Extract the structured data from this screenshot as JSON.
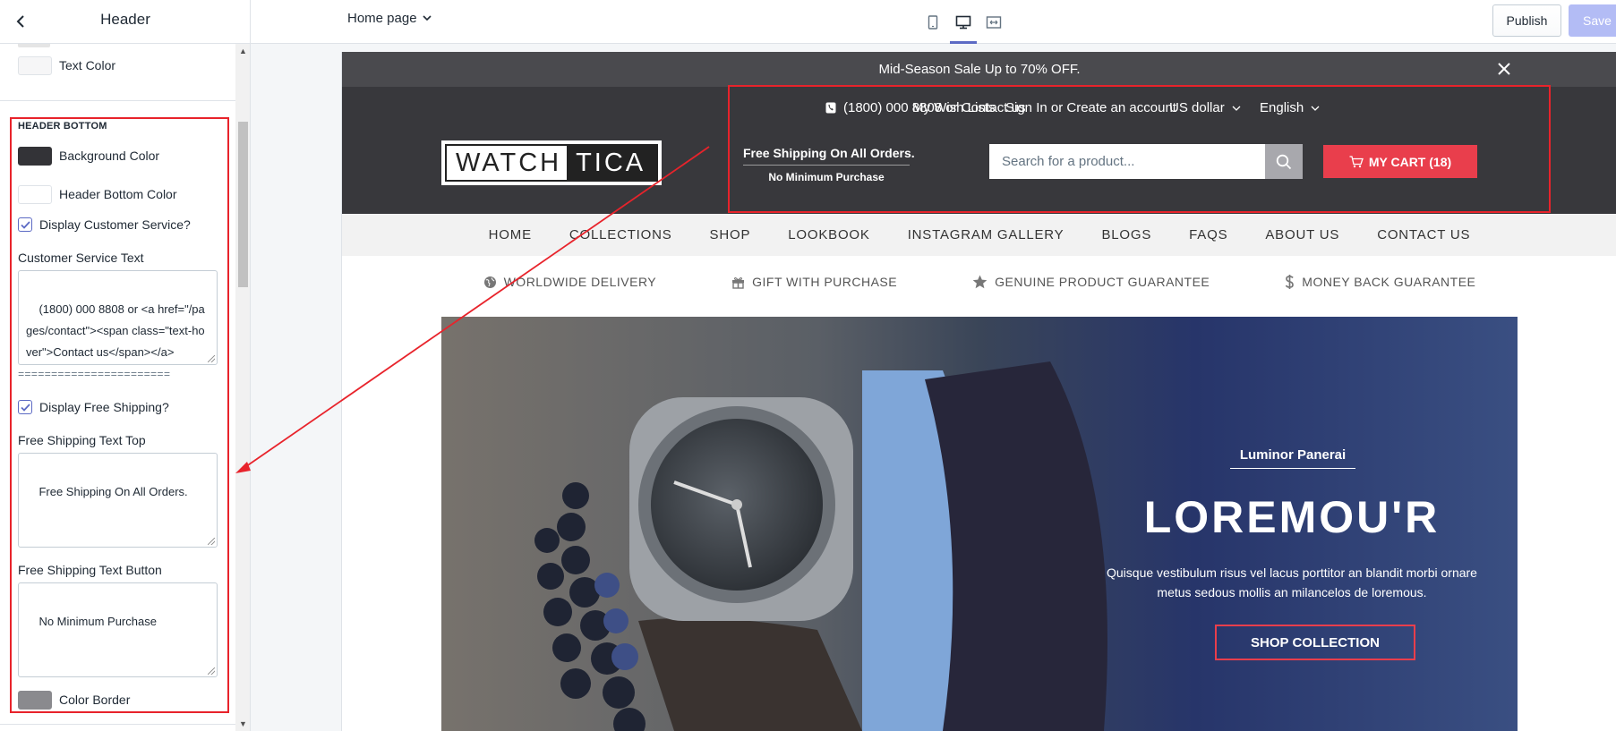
{
  "topbar": {
    "title": "Header",
    "page_select": "Home page",
    "publish_label": "Publish",
    "save_label": "Save",
    "accent_color": "#5c6ac4"
  },
  "panel": {
    "text_color_label": "Text Color",
    "section_title": "HEADER BOTTOM",
    "bg_color_label": "Background Color",
    "bg_color": "#333337",
    "header_bottom_color_label": "Header Bottom Color",
    "header_bottom_color": "#ffffff",
    "display_customer_service_label": "Display Customer Service?",
    "display_customer_service": true,
    "customer_service_text_label": "Customer Service Text",
    "customer_service_text": "(1800) 000 8808 or <a href=\"/pages/contact\"><span class=\"text-hover\">Contact us</span></a>",
    "separator": "=======================",
    "display_free_shipping_label": "Display Free Shipping?",
    "display_free_shipping": true,
    "free_shipping_top_label": "Free Shipping Text Top",
    "free_shipping_top": "Free Shipping On All Orders.",
    "free_shipping_button_label": "Free Shipping Text Button",
    "free_shipping_button": "No Minimum Purchase",
    "color_border_label": "Color Border",
    "color_border": "#8a8a8e"
  },
  "preview": {
    "announcement": "Mid-Season Sale Up to 70% OFF.",
    "logo": {
      "part1": "WATCH",
      "part2": "TICA"
    },
    "header_links": {
      "phone_text": "(1800) 000 8808 or Contact us",
      "wish_lists": "My Wish Lists",
      "sign_in": "Sign In or Create an account",
      "currency": "US dollar",
      "language": "English"
    },
    "free_shipping_top": "Free Shipping On All Orders.",
    "free_shipping_bottom": "No Minimum Purchase",
    "search_placeholder": "Search for a product...",
    "cart_label": "MY CART (18)",
    "cart_color": "#e93e4c",
    "nav": [
      "HOME",
      "COLLECTIONS",
      "SHOP",
      "LOOKBOOK",
      "INSTAGRAM GALLERY",
      "BLOGS",
      "FAQS",
      "ABOUT US",
      "CONTACT US"
    ],
    "usps": [
      {
        "icon": "globe-icon",
        "label": "WORLDWIDE DELIVERY"
      },
      {
        "icon": "gift-icon",
        "label": "GIFT WITH PURCHASE"
      },
      {
        "icon": "star-icon",
        "label": "GENUINE PRODUCT GUARANTEE"
      },
      {
        "icon": "dollar-icon",
        "label": "MONEY BACK GUARANTEE"
      }
    ],
    "hero": {
      "eyebrow": "Luminor Panerai",
      "title": "LOREMOU'R",
      "description": "Quisque vestibulum risus vel lacus porttitor an blandit morbi ornare metus sedous mollis an milancelos de loremous.",
      "button": "SHOP COLLECTION"
    }
  }
}
